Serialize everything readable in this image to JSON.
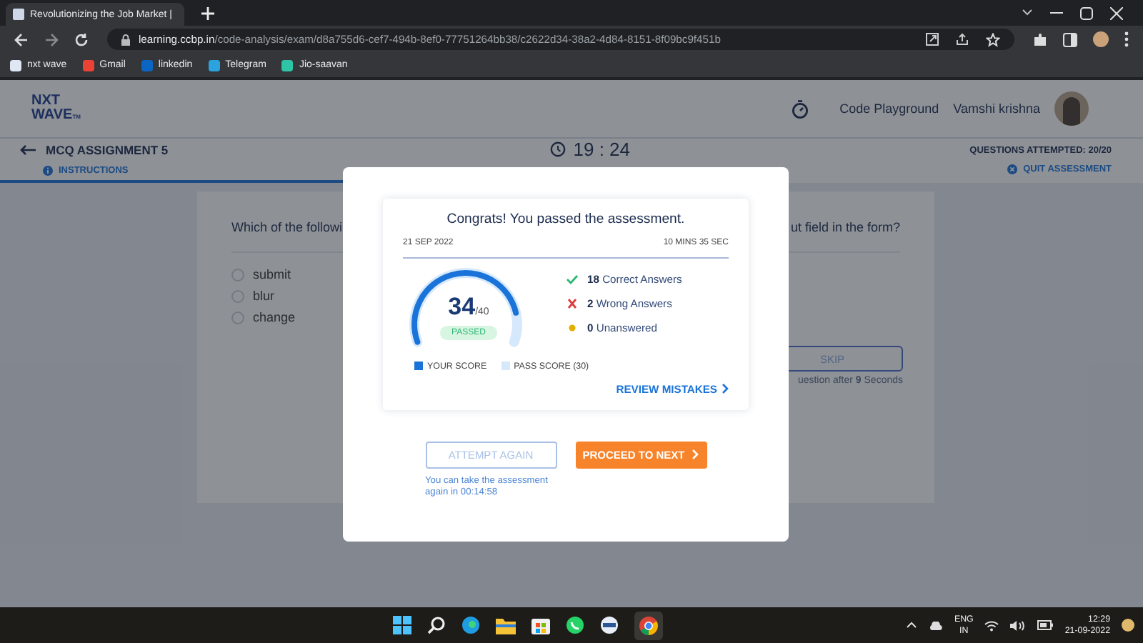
{
  "browser": {
    "tab_title": "Revolutionizing the Job Market |",
    "url_host": "learning.ccbp.in",
    "url_path": "/code-analysis/exam/d8a755d6-cef7-494b-8ef0-77751264bb38/c2622d34-38a2-4d84-8151-8f09bc9f451b",
    "bookmarks": [
      {
        "label": "nxt wave",
        "kind": "site"
      },
      {
        "label": "Gmail",
        "kind": "mail"
      },
      {
        "label": "linkedin",
        "kind": "in"
      },
      {
        "label": "Telegram",
        "kind": "telegram"
      },
      {
        "label": "Jio-saavan",
        "kind": "music"
      }
    ]
  },
  "header": {
    "logo": {
      "line1": "NXT",
      "line2": "WAVE",
      "mark": "TM"
    },
    "playground": "Code Playground",
    "user": "Vamshi krishna"
  },
  "assessment": {
    "title": "MCQ ASSIGNMENT 5",
    "instructions": "INSTRUCTIONS",
    "timer": "19 : 24",
    "attempted": "QUESTIONS ATTEMPTED: 20/20",
    "quit": "QUIT ASSESSMENT",
    "progress": {
      "level": 0.59
    }
  },
  "question": {
    "text_left": "Which of the followi",
    "text_right": "ut field in the form?",
    "options": [
      {
        "label": "submit",
        "selected": false
      },
      {
        "label": "blur",
        "selected": false
      },
      {
        "label": "change",
        "selected": false
      }
    ],
    "skip": "SKIP",
    "skip_note": "uestion after **9** Seconds"
  },
  "modal": {
    "heading": "Congrats! You passed the assessment.",
    "date": "21 SEP 2022",
    "duration": "10 MINS 35 SEC",
    "score": "34",
    "total": "/40",
    "status": "PASSED",
    "level": 0.85,
    "stats": [
      {
        "kind": "correct",
        "count": "18",
        "label": "Correct Answers"
      },
      {
        "kind": "wrong",
        "count": "2",
        "label": "Wrong Answers"
      },
      {
        "kind": "unanswered",
        "count": "0",
        "label": "Unanswered"
      }
    ],
    "legend": [
      "YOUR SCORE",
      "PASS SCORE (30)"
    ],
    "review": "REVIEW MISTAKES",
    "attempt": {
      "label": "ATTEMPT AGAIN",
      "disabled": true
    },
    "proceed": "PROCEED TO NEXT",
    "retry_note": "You can take the assessment again in 00:14:58"
  },
  "taskbar": {
    "lang": "ENG",
    "region": "IN",
    "time": "12:29",
    "date": "21-09-2022"
  }
}
